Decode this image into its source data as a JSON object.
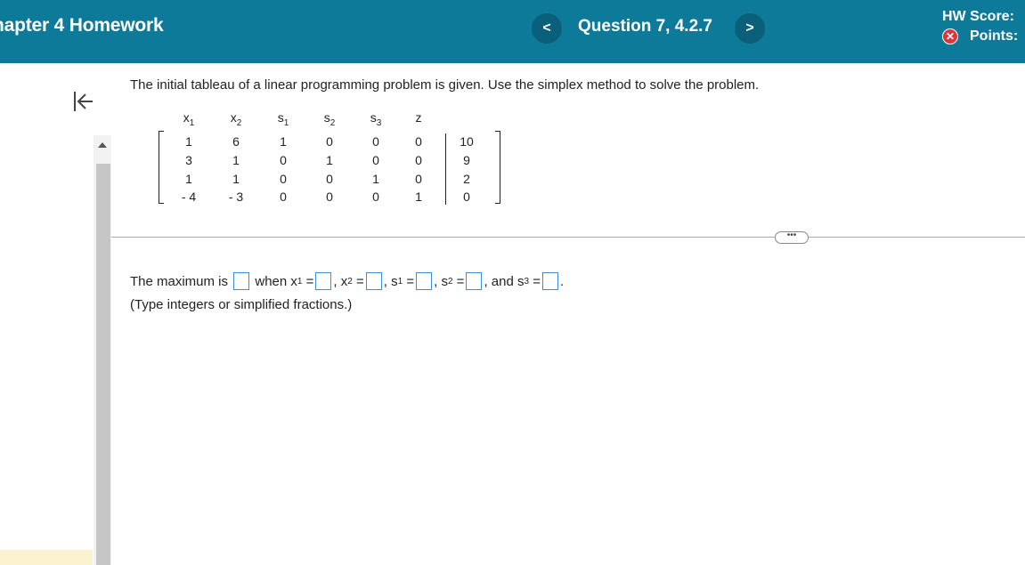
{
  "header": {
    "course_title": "hapter 4 Homework",
    "question_label": "Question 7, 4.2.7",
    "prev_symbol": "<",
    "next_symbol": ">",
    "hw_score_label": "HW Score:",
    "points_label": "Points:"
  },
  "problem": {
    "instruction": "The initial tableau of a linear programming problem is given. Use the simplex method to solve the problem.",
    "tableau": {
      "headers": [
        {
          "var": "x",
          "sub": "1"
        },
        {
          "var": "x",
          "sub": "2"
        },
        {
          "var": "s",
          "sub": "1"
        },
        {
          "var": "s",
          "sub": "2"
        },
        {
          "var": "s",
          "sub": "3"
        },
        {
          "var": "z",
          "sub": ""
        },
        {
          "var": "",
          "sub": ""
        }
      ],
      "rows": [
        [
          "1",
          "6",
          "1",
          "0",
          "0",
          "0",
          "10"
        ],
        [
          "3",
          "1",
          "0",
          "1",
          "0",
          "0",
          "9"
        ],
        [
          "1",
          "1",
          "0",
          "0",
          "1",
          "0",
          "2"
        ],
        [
          "- 4",
          "- 3",
          "0",
          "0",
          "0",
          "1",
          "0"
        ]
      ]
    }
  },
  "answer": {
    "t_max": "The maximum is",
    "t_when": "when x",
    "sub_1": "1",
    "sub_2": "2",
    "sub_3": "3",
    "eq": "=",
    "comma": ",",
    "t_x": "x",
    "t_s": "s",
    "t_and": ", and s",
    "period": ".",
    "fields": {
      "max": "",
      "x1": "",
      "x2": "",
      "s1": "",
      "s2": "",
      "s3": ""
    },
    "hint": "(Type integers or simplified fractions.)"
  },
  "colors": {
    "header_bg": "#0e7a99",
    "input_border": "#3a8fd8",
    "error_icon": "#d9363e"
  },
  "icons": [
    "chevron-left-icon",
    "chevron-right-icon",
    "x-circle-icon",
    "collapse-left-icon",
    "more-icon"
  ]
}
